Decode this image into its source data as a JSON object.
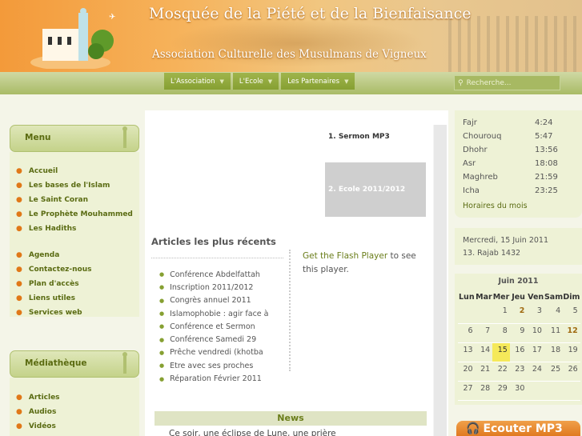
{
  "header": {
    "title": "Mosquée de la Piété et de la Bienfaisance",
    "subtitle": "Association Culturelle des Musulmans de Vigneux"
  },
  "nav": [
    {
      "label": "L'Association"
    },
    {
      "label": "L'Ecole"
    },
    {
      "label": "Les Partenaires"
    }
  ],
  "search": {
    "placeholder": "Recherche..."
  },
  "menu": {
    "title": "Menu",
    "items": [
      "Accueil",
      "Les bases de l'Islam",
      "Le Saint Coran",
      "Le Prophète Mouhammed",
      "Les Hadiths"
    ],
    "items2": [
      "Agenda",
      "Contactez-nous",
      "Plan d'accès",
      "Liens utiles",
      "Services web"
    ]
  },
  "media": {
    "title": "Médiathèque",
    "items": [
      "Articles",
      "Audios",
      "Vidéos"
    ]
  },
  "slider": {
    "tab1": "1. Sermon MP3",
    "tab2": "2. Ecole 2011/2012"
  },
  "recent": {
    "title": "Articles les plus récents",
    "items": [
      "Conférence Abdelfattah",
      "Inscription 2011/2012",
      "Congrès annuel 2011",
      "Islamophobie : agir face à",
      "Conférence et Sermon",
      "Conférence Samedi 29",
      "Prêche vendredi (khotba",
      "Etre avec ses proches",
      "Réparation Février 2011"
    ]
  },
  "flash": {
    "link": "Get the Flash Player",
    "rest": " to see this player."
  },
  "news": {
    "title": "News",
    "text": "Ce soir, une éclipse de Lune, une prière"
  },
  "prayer": {
    "times": [
      {
        "name": "Fajr",
        "time": "4:24"
      },
      {
        "name": "Chourouq",
        "time": "5:47"
      },
      {
        "name": "Dhohr",
        "time": "13:56"
      },
      {
        "name": "Asr",
        "time": "18:08"
      },
      {
        "name": "Maghreb",
        "time": "21:59"
      },
      {
        "name": "Icha",
        "time": "23:25"
      }
    ],
    "link": "Horaires du mois"
  },
  "date": {
    "gregorian": "Mercredi, 15 Juin 2011",
    "hijri": "13. Rajab 1432"
  },
  "calendar": {
    "title": "Juin 2011",
    "days": [
      "Lun",
      "Mar",
      "Mer",
      "Jeu",
      "Ven",
      "Sam",
      "Dim"
    ],
    "weeks": [
      [
        "",
        "",
        "1",
        "2",
        "3",
        "4",
        "5"
      ],
      [
        "6",
        "7",
        "8",
        "9",
        "10",
        "11",
        "12"
      ],
      [
        "13",
        "14",
        "15",
        "16",
        "17",
        "18",
        "19"
      ],
      [
        "20",
        "21",
        "22",
        "23",
        "24",
        "25",
        "26"
      ],
      [
        "27",
        "28",
        "29",
        "30",
        "",
        "",
        ""
      ]
    ],
    "today": "15",
    "event_days": [
      "2",
      "12"
    ]
  },
  "listen": {
    "label": "Ecouter MP3"
  },
  "colors": {
    "accent": "#86a032",
    "banner": "#f39a3a",
    "today": "#f5e95a"
  }
}
